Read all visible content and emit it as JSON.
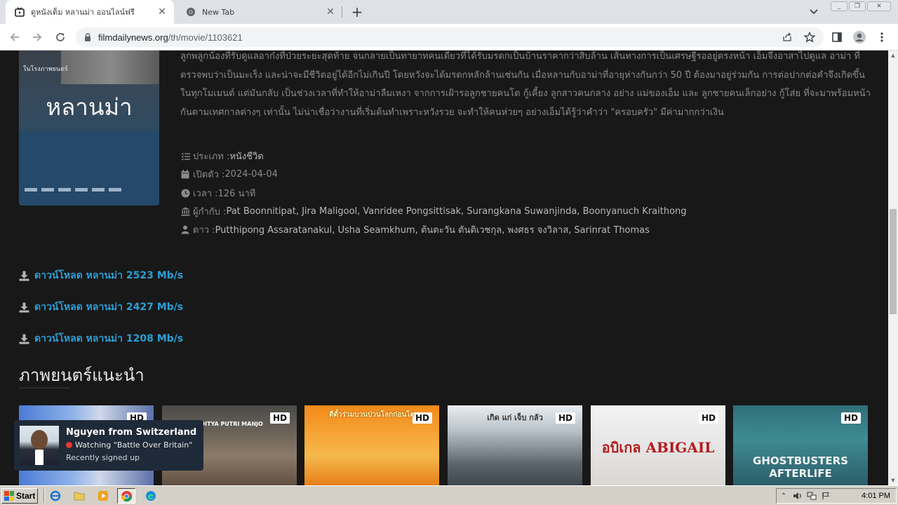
{
  "browser": {
    "tabs": [
      {
        "title": "ดูหนังเต็ม หลานม่า ออนไลน์ฟรี",
        "active": true
      },
      {
        "title": "New Tab",
        "active": false
      }
    ],
    "url_host": "filmdailynews.org",
    "url_path": "/th/movie/1103621"
  },
  "movie": {
    "synopsis": "ลูกพลูกน้องที่รับดูแลอาก๋งที่ป่วยระยะสุดท้าย จนกลายเป็นทายาทคนเดียวที่ได้รับมรดกเป็นบ้านราคากว่าสิบล้าน เส้นทางการเป็นเศรษฐีรออยู่ตรงหน้า เอ็มจึงอาสาไปดูแล อาม่า ที่ตรวจพบว่าเป็นมะเร็ง และน่าจะมีชีวิตอยู่ได้อีกไม่เกินปี โดยหวังจะได้มรดกหลักล้านเช่นกัน เมื่อหลานกับอาม่าที่อายุห่างกันกว่า 50 ปี ต้องมาอยู่ร่วมกัน การต่อปากต่อคำจึงเกิดขึ้นในทุกโมเมนต์ แต่มันกลับ เป็นช่วงเวลาที่ทำให้อาม่าลืมเหงา จากการเฝ้ารอลูกชายคนโต กู้เคี้ยง ลูกสาวคนกลาง อย่าง แม่ของเอ็ม และ ลูกชายคนเล็กอย่าง กู้โส่ย ที่จะมาพร้อมหน้ากันตามเทศกาลต่างๆ เท่านั้น ไม่น่าเชื่อว่างานที่เริ่มต้นทำเพราะหวังรวย จะทำให้คนห่วยๆ อย่างเอ็มได้รู้ว่าคำว่า \"ครอบครัว\" มีค่ามากกว่าเงิน",
    "poster_title": "หลานม่า",
    "poster_tagline": "ในโรงภาพยนตร์",
    "genre_label": "ประเภท : ",
    "genre": "หนังชีวิต",
    "release_label": "เปิดตัว : ",
    "release": "2024-04-04",
    "runtime_label": "เวลา : ",
    "runtime": "126 นาที",
    "director_label": "ผู้กำกับ : ",
    "directors": "Pat Boonnitipat, Jira Maligool, Vanridee Pongsittisak, Surangkana Suwanjinda, Boonyanuch Kraithong",
    "cast_label": "ดาว : ",
    "cast": "Putthipong Assaratanakul, Usha Seamkhum, ต้นตะวัน ตันติเวชกุล, พงศธร จงวิลาส, Sarinrat Thomas"
  },
  "downloads": [
    {
      "label": "ดาวน์โหลด หลานม่า 2523 Mb/s"
    },
    {
      "label": "ดาวน์โหลด หลานม่า 2427 Mb/s"
    },
    {
      "label": "ดาวน์โหลด หลานม่า 1208 Mb/s"
    }
  ],
  "recommended": {
    "title": "ภาพยนตร์แนะนำ",
    "cards": [
      {
        "badge": "HD",
        "text": ""
      },
      {
        "badge": "HD",
        "text": "ADITYA  PUTRI MANJO"
      },
      {
        "badge": "HD",
        "text": "ตีตั้วร่วมบวนป่วนโลกก่อนโต"
      },
      {
        "badge": "HD",
        "text": "เกิด แก่ เจ็บ กลัว"
      },
      {
        "badge": "HD",
        "text": "อบิเกล ABIGAIL"
      },
      {
        "badge": "HD",
        "text": "GHOSTBUSTERS AFTERLIFE"
      }
    ]
  },
  "notification": {
    "name": "Nguyen from Switzerland",
    "watching": "Watching \"Battle Over Britain\"",
    "status": "Recently signed up"
  },
  "taskbar": {
    "start_label": "Start",
    "clock": "4:01 PM"
  },
  "colors": {
    "link": "#2b9fd6",
    "page_bg": "#181818",
    "toast_bg": "#1e2a38"
  }
}
